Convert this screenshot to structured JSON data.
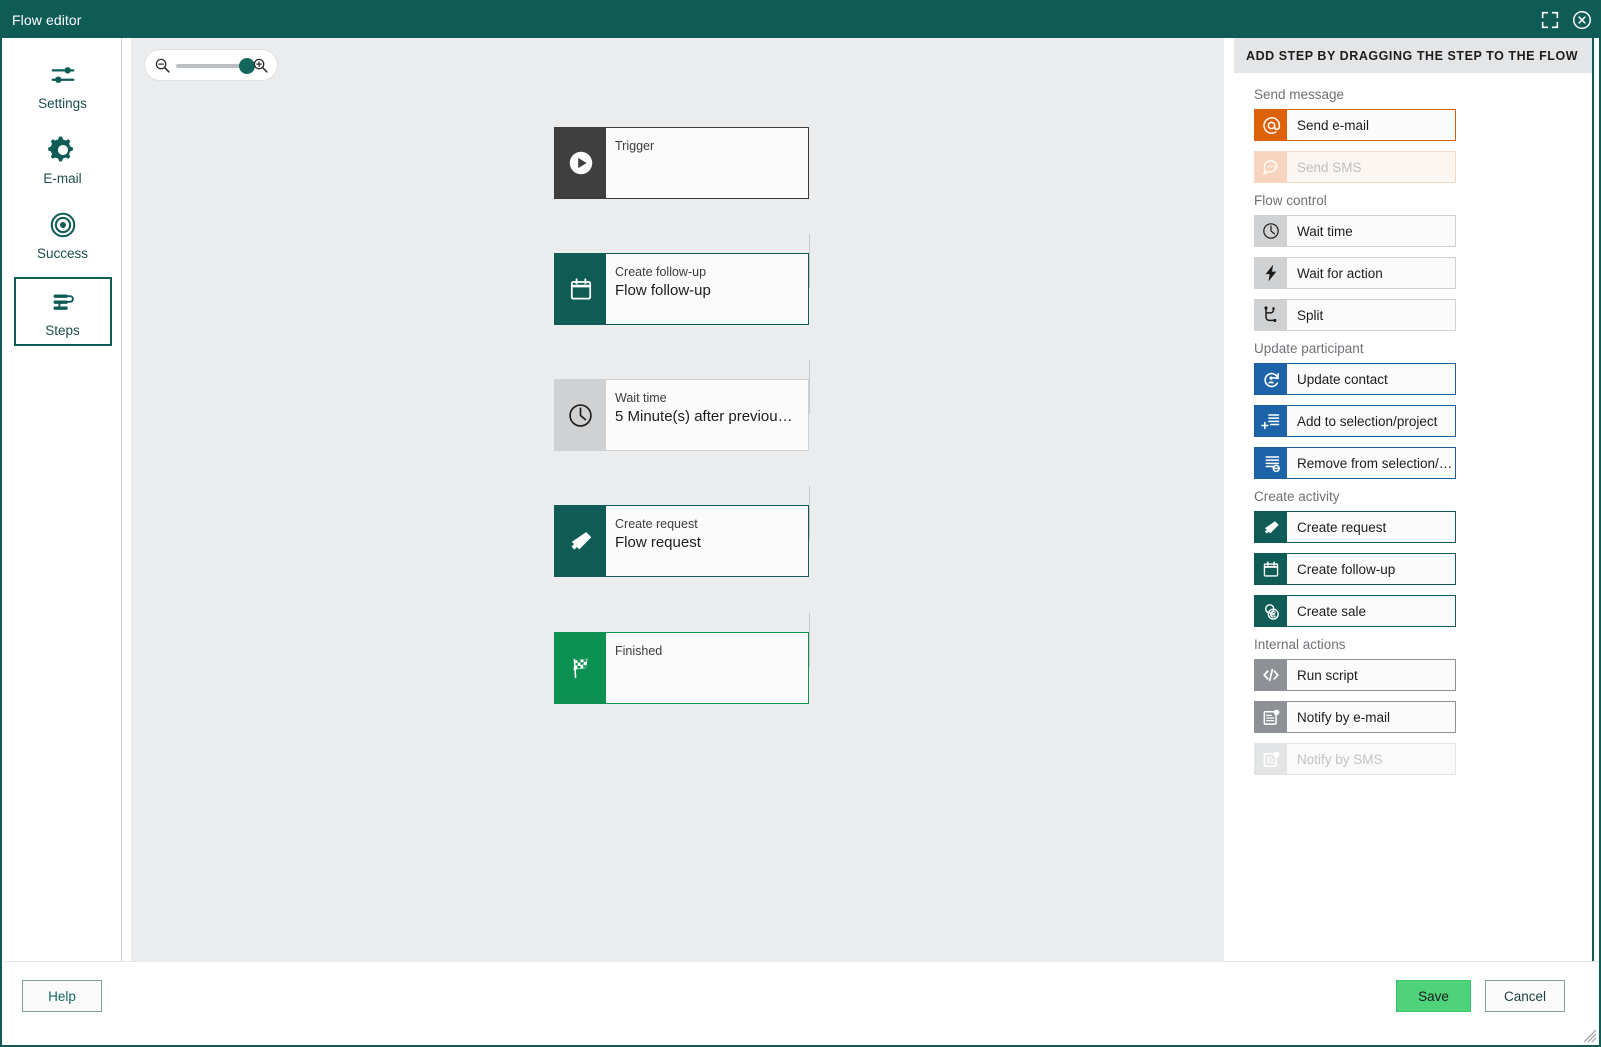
{
  "window": {
    "title": "Flow editor",
    "maximize_icon": "expand-icon",
    "close_icon": "close-circle-icon"
  },
  "sidebar": {
    "items": [
      {
        "label": "Settings",
        "icon": "sliders-icon",
        "selected": false
      },
      {
        "label": "E-mail",
        "icon": "gear-icon",
        "selected": false
      },
      {
        "label": "Success",
        "icon": "target-icon",
        "selected": false
      },
      {
        "label": "Steps",
        "icon": "steps-icon",
        "selected": true
      }
    ]
  },
  "canvas": {
    "zoom_control": {
      "zoom_out_icon": "magnifier-minus-icon",
      "zoom_in_icon": "magnifier-plus-icon",
      "value_percent": 80
    },
    "nodes": [
      {
        "kind": "Trigger",
        "name": "",
        "icon": "play-icon",
        "theme": "dark"
      },
      {
        "kind": "Create follow-up",
        "name": "Flow follow-up",
        "icon": "calendar-icon",
        "theme": "teal"
      },
      {
        "kind": "Wait time",
        "name": "5 Minute(s) after previou…",
        "icon": "clock-icon",
        "theme": "grey"
      },
      {
        "kind": "Create request",
        "name": "Flow request",
        "icon": "ticket-icon",
        "theme": "teal"
      },
      {
        "kind": "Finished",
        "name": "",
        "icon": "checkered-flag-icon",
        "theme": "green"
      }
    ]
  },
  "right_panel": {
    "header": "ADD STEP BY DRAGGING THE STEP TO THE FLOW",
    "groups": [
      {
        "label": "Send message",
        "items": [
          {
            "label": "Send e-mail",
            "icon": "at-sign-icon",
            "theme": "orange",
            "enabled": true
          },
          {
            "label": "Send SMS",
            "icon": "chat-bubble-icon",
            "theme": "orange-dim",
            "enabled": false
          }
        ]
      },
      {
        "label": "Flow control",
        "items": [
          {
            "label": "Wait time",
            "icon": "clock-icon",
            "theme": "grey",
            "enabled": true
          },
          {
            "label": "Wait for action",
            "icon": "lightning-icon",
            "theme": "grey",
            "enabled": true
          },
          {
            "label": "Split",
            "icon": "split-icon",
            "theme": "grey",
            "enabled": true
          }
        ]
      },
      {
        "label": "Update participant",
        "items": [
          {
            "label": "Add to selection/project",
            "icon": "list-plus-icon",
            "theme": "blue",
            "enabled": true
          },
          {
            "label": "Update contact",
            "icon": "refresh-user-icon",
            "theme": "blue",
            "enabled": true
          },
          {
            "label": "Remove from selection/…",
            "icon": "list-minus-icon",
            "theme": "blue",
            "enabled": true
          }
        ]
      },
      {
        "label": "Create activity",
        "items": [
          {
            "label": "Create request",
            "icon": "ticket-icon",
            "theme": "teal",
            "enabled": true
          },
          {
            "label": "Create follow-up",
            "icon": "calendar-icon",
            "theme": "teal",
            "enabled": true
          },
          {
            "label": "Create sale",
            "icon": "coins-icon",
            "theme": "teal",
            "enabled": true
          }
        ]
      },
      {
        "label": "Internal actions",
        "items": [
          {
            "label": "Run script",
            "icon": "code-icon",
            "theme": "greydark",
            "enabled": true
          },
          {
            "label": "Notify by e-mail",
            "icon": "notification-icon",
            "theme": "greydark",
            "enabled": true
          },
          {
            "label": "Notify by SMS",
            "icon": "notification-icon",
            "theme": "greydark-dim",
            "enabled": false
          }
        ]
      }
    ]
  },
  "footer": {
    "help_label": "Help",
    "save_label": "Save",
    "cancel_label": "Cancel"
  },
  "colors": {
    "brand_teal": "#0f5c56",
    "accent_orange": "#dd6206",
    "accent_blue": "#1c63a7",
    "accent_green": "#0c9152",
    "save_green": "#4fd37a",
    "canvas_bg": "#ebecee"
  }
}
